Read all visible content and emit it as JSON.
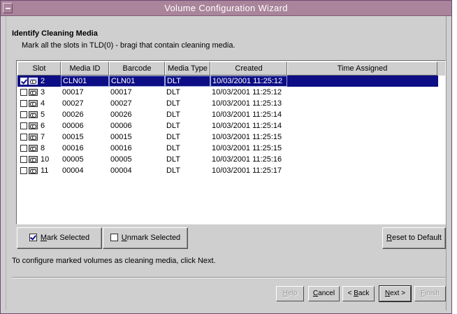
{
  "window": {
    "title": "Volume Configuration Wizard"
  },
  "page": {
    "heading": "Identify Cleaning Media",
    "subheading": "Mark all the slots in TLD(0) - bragi that contain cleaning media."
  },
  "table": {
    "columns": [
      "Slot",
      "Media ID",
      "Barcode",
      "Media Type",
      "Created",
      "Time Assigned"
    ],
    "rows": [
      {
        "slot": "2",
        "media_id": "CLN01",
        "barcode": "CLN01",
        "media_type": "DLT",
        "created": "10/03/2001 11:25:12",
        "time_assigned": "",
        "checked": true,
        "selected": true
      },
      {
        "slot": "3",
        "media_id": "00017",
        "barcode": "00017",
        "media_type": "DLT",
        "created": "10/03/2001 11:25:12",
        "time_assigned": "",
        "checked": false,
        "selected": false
      },
      {
        "slot": "4",
        "media_id": "00027",
        "barcode": "00027",
        "media_type": "DLT",
        "created": "10/03/2001 11:25:13",
        "time_assigned": "",
        "checked": false,
        "selected": false
      },
      {
        "slot": "5",
        "media_id": "00026",
        "barcode": "00026",
        "media_type": "DLT",
        "created": "10/03/2001 11:25:14",
        "time_assigned": "",
        "checked": false,
        "selected": false
      },
      {
        "slot": "6",
        "media_id": "00006",
        "barcode": "00006",
        "media_type": "DLT",
        "created": "10/03/2001 11:25:14",
        "time_assigned": "",
        "checked": false,
        "selected": false
      },
      {
        "slot": "7",
        "media_id": "00015",
        "barcode": "00015",
        "media_type": "DLT",
        "created": "10/03/2001 11:25:15",
        "time_assigned": "",
        "checked": false,
        "selected": false
      },
      {
        "slot": "8",
        "media_id": "00016",
        "barcode": "00016",
        "media_type": "DLT",
        "created": "10/03/2001 11:25:15",
        "time_assigned": "",
        "checked": false,
        "selected": false
      },
      {
        "slot": "10",
        "media_id": "00005",
        "barcode": "00005",
        "media_type": "DLT",
        "created": "10/03/2001 11:25:16",
        "time_assigned": "",
        "checked": false,
        "selected": false
      },
      {
        "slot": "11",
        "media_id": "00004",
        "barcode": "00004",
        "media_type": "DLT",
        "created": "10/03/2001 11:25:17",
        "time_assigned": "",
        "checked": false,
        "selected": false
      }
    ]
  },
  "actions": {
    "mark_selected": {
      "mnemonic": "M",
      "rest": "ark Selected"
    },
    "unmark_selected": {
      "mnemonic": "U",
      "rest": "nmark Selected"
    },
    "reset_default": {
      "pre": "",
      "mnemonic": "R",
      "rest": "eset to Default"
    }
  },
  "hint": "To configure marked volumes as cleaning media, click Next.",
  "nav": {
    "help": {
      "mnemonic": "H",
      "rest": "elp"
    },
    "cancel": {
      "mnemonic": "C",
      "rest": "ancel"
    },
    "back": {
      "pre": "< ",
      "mnemonic": "B",
      "rest": "ack"
    },
    "next": {
      "mnemonic": "N",
      "rest": "ext >"
    },
    "finish": {
      "mnemonic": "F",
      "rest": "inish"
    }
  },
  "colors": {
    "titlebar": "#a9849a",
    "selection": "#0d0d85",
    "panel": "#cfcfcf"
  },
  "icons": {
    "row_media": "tape-cartridge-icon",
    "window_menu": "window-menu-icon"
  }
}
